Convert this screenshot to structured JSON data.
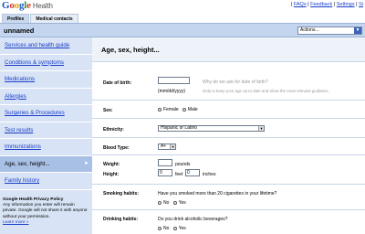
{
  "header": {
    "logo_text": "Google",
    "product": "Health",
    "links": [
      "FAQs",
      "Feedback",
      "Settings",
      "Si"
    ]
  },
  "tabs": [
    "Profiles",
    "Medical contacts"
  ],
  "profile": {
    "name": "unnamed",
    "actions_label": "Actions..."
  },
  "sidebar": {
    "items": [
      {
        "label": "Services and health guide"
      },
      {
        "label": "Conditions & symptoms"
      },
      {
        "label": "Medications"
      },
      {
        "label": "Allergies"
      },
      {
        "label": "Surgeries & Procedures"
      },
      {
        "label": "Test results"
      },
      {
        "label": "Immunizations"
      },
      {
        "label": "Age, sex, height..."
      },
      {
        "label": "Family history"
      }
    ],
    "privacy": {
      "title": "Google Health Privacy Policy",
      "body": "Any information you enter will remain private. Google will not share it with anyone without your permission.",
      "link": "Learn more »"
    }
  },
  "main": {
    "title": "Age, sex, height...",
    "dob": {
      "label": "Date of birth:",
      "hint": "(mm/dd/yyyy)",
      "why": "Why do we ask for date of birth?",
      "why_detail": "Only to keep your age up to date and show the most relevant guidance."
    },
    "sex": {
      "label": "Sex:",
      "options": [
        "Female",
        "Male"
      ]
    },
    "ethnicity": {
      "label": "Ethnicity:",
      "value": "Hispanic or Latino"
    },
    "blood": {
      "label": "Blood Type:",
      "value": "A+"
    },
    "weight": {
      "label": "Weight:",
      "unit": "pounds"
    },
    "height": {
      "label": "Height:",
      "feet_value": "0",
      "feet_unit": "feet",
      "inches_value": "0",
      "inches_unit": "inches"
    },
    "smoking": {
      "label": "Smoking habits:",
      "question": "Have you smoked more than 20 cigarettes in your lifetime?",
      "options": [
        "No",
        "Yes"
      ]
    },
    "drinking": {
      "label": "Drinking habits:",
      "question": "Do you drink alcoholic beverages?",
      "options": [
        "No",
        "Yes"
      ]
    }
  }
}
